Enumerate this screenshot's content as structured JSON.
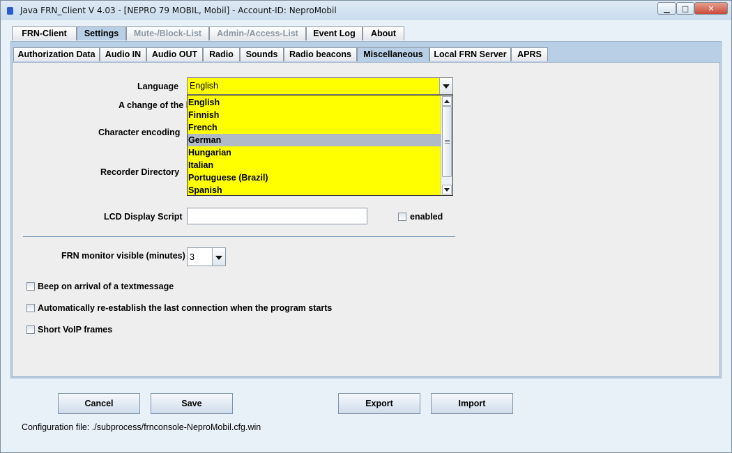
{
  "window": {
    "title": "Java FRN_Client V 4.03 - [NEPRO 79 MOBIL, Mobil] - Account-ID: NeproMobil",
    "minimize_icon": "minimize-icon",
    "maximize_icon": "maximize-icon",
    "close_icon": "close-icon"
  },
  "main_tabs": [
    {
      "label": "FRN-Client"
    },
    {
      "label": "Settings"
    },
    {
      "label": "Mute-/Block-List"
    },
    {
      "label": "Admin-/Access-List"
    },
    {
      "label": "Event Log"
    },
    {
      "label": "About"
    }
  ],
  "sub_tabs": [
    {
      "label": "Authorization Data"
    },
    {
      "label": "Audio IN"
    },
    {
      "label": "Audio OUT"
    },
    {
      "label": "Radio"
    },
    {
      "label": "Sounds"
    },
    {
      "label": "Radio beacons"
    },
    {
      "label": "Miscellaneous"
    },
    {
      "label": "Local FRN Server"
    },
    {
      "label": "APRS"
    }
  ],
  "settings": {
    "language_label": "Language",
    "language_value": "English",
    "language_options": [
      "English",
      "Finnish",
      "French",
      "German",
      "Hungarian",
      "Italian",
      "Portuguese (Brazil)",
      "Spanish"
    ],
    "language_highlighted": "German",
    "change_note": "A change of the la",
    "encoding_label": "Character encoding",
    "recorder_label": "Recorder Directory",
    "lcd_label": "LCD Display Script",
    "lcd_value": "",
    "enabled_label": "enabled",
    "monitor_label": "FRN monitor visible (minutes)",
    "monitor_value": "3",
    "checkbox_beep": "Beep on arrival of a textmessage",
    "checkbox_reconnect": "Automatically re-establish the last connection when the program starts",
    "checkbox_short_voip": "Short VoIP frames"
  },
  "buttons": {
    "cancel": "Cancel",
    "save": "Save",
    "export": "Export",
    "import": "Import"
  },
  "config_file": "Configuration file:  ./subprocess/frnconsole-NeproMobil.cfg.win",
  "colors": {
    "language_bg": "#ffff00",
    "highlight": "#b0b9c6",
    "active_tab": "#b8cfe5"
  }
}
